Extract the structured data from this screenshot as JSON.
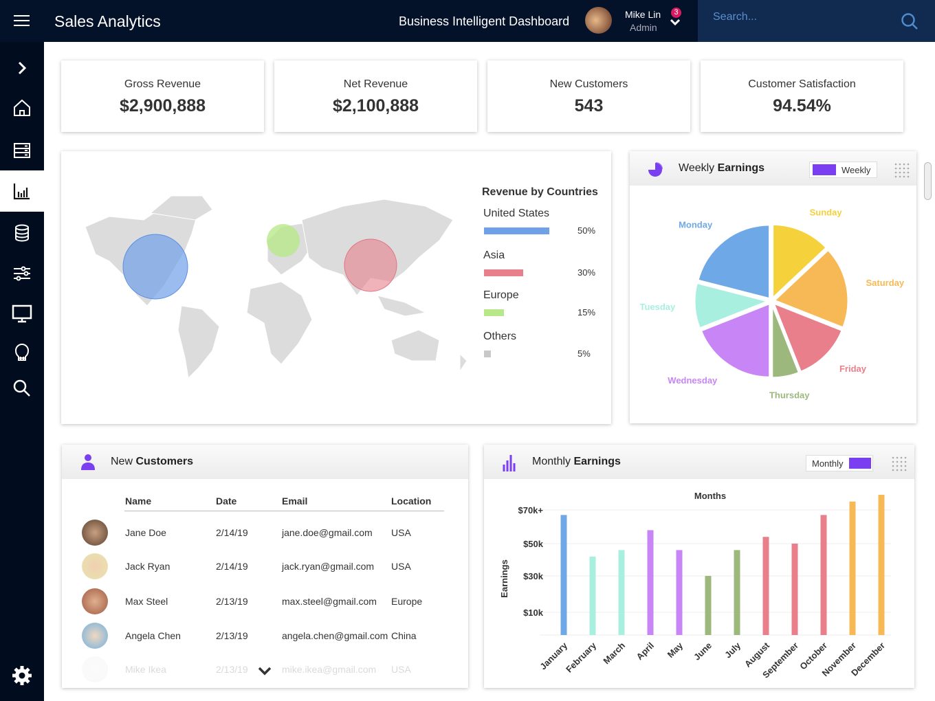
{
  "header": {
    "app_title": "Sales Analytics",
    "subtitle": "Business Intelligent Dashboard",
    "user_name": "Mike Lin",
    "user_role": "Admin",
    "notification_count": "3",
    "search_placeholder": "Search..."
  },
  "sidebar": {
    "items": [
      "expand",
      "home",
      "server",
      "analytics",
      "database",
      "settings-sliders",
      "monitor",
      "ideas",
      "search",
      "gear"
    ],
    "active": "analytics"
  },
  "kpis": [
    {
      "label": "Gross Revenue",
      "value": "$2,900,888"
    },
    {
      "label": "Net Revenue",
      "value": "$2,100,888"
    },
    {
      "label": "New Customers",
      "value": "543"
    },
    {
      "label": "Customer Satisfaction",
      "value": "94.54%"
    }
  ],
  "revenue_by_countries": {
    "title": "Revenue by Countries",
    "items": [
      {
        "name": "United States",
        "percent": "50%",
        "value": 50,
        "color": "#6fa0e8"
      },
      {
        "name": "Asia",
        "percent": "30%",
        "value": 30,
        "color": "#e8808c"
      },
      {
        "name": "Europe",
        "percent": "15%",
        "value": 15,
        "color": "#b8e88a"
      },
      {
        "name": "Others",
        "percent": "5%",
        "value": 5,
        "color": "#c8c8c8"
      }
    ]
  },
  "weekly": {
    "title_pre": "Weekly ",
    "title_bold": "Earnings",
    "toggle_label": "Weekly",
    "accent": "#7b3ff2",
    "chart_data": {
      "type": "pie",
      "slices": [
        {
          "label": "Sunday",
          "value": 13,
          "color": "#f5d13b"
        },
        {
          "label": "Saturday",
          "value": 18,
          "color": "#f7b955"
        },
        {
          "label": "Friday",
          "value": 13,
          "color": "#e87f8a"
        },
        {
          "label": "Thursday",
          "value": 6,
          "color": "#9db87c"
        },
        {
          "label": "Wednesday",
          "value": 19,
          "color": "#c885f5"
        },
        {
          "label": "Tuesday",
          "value": 10,
          "color": "#a8efe0"
        },
        {
          "label": "Monday",
          "value": 21,
          "color": "#6fa8e6"
        }
      ]
    }
  },
  "customers": {
    "title_pre": "New ",
    "title_bold": "Customers",
    "columns": [
      "Name",
      "Date",
      "Email",
      "Location"
    ],
    "rows": [
      {
        "name": "Jane Doe",
        "date": "2/14/19",
        "email": "jane.doe@gmail.com",
        "location": "USA"
      },
      {
        "name": "Jack Ryan",
        "date": "2/14/19",
        "email": "jack.ryan@gmail.com",
        "location": "USA"
      },
      {
        "name": "Max Steel",
        "date": "2/13/19",
        "email": "max.steel@gmail.com",
        "location": "Europe"
      },
      {
        "name": "Angela Chen",
        "date": "2/13/19",
        "email": "angela.chen@gmail.com",
        "location": "China"
      },
      {
        "name": "Mike Ikea",
        "date": "2/13/19",
        "email": "mike.ikea@gmail.com",
        "location": "USA"
      }
    ]
  },
  "monthly": {
    "title_pre": "Monthly ",
    "title_bold": "Earnings",
    "toggle_label": "Monthly",
    "chart_data": {
      "type": "bar",
      "title": "Months",
      "ylabel": "Earnings",
      "yticks": [
        "$10k",
        "$30k",
        "$50k",
        "$70k+"
      ],
      "grid": true,
      "categories": [
        "January",
        "February",
        "March",
        "April",
        "May",
        "June",
        "July",
        "August",
        "September",
        "October",
        "November",
        "December"
      ],
      "values": [
        67,
        42,
        46,
        58,
        46,
        30,
        46,
        54,
        50,
        67,
        75,
        79
      ],
      "colors": [
        "#6fa8e6",
        "#a8efe0",
        "#a8efe0",
        "#c885f5",
        "#c885f5",
        "#9db87c",
        "#9db87c",
        "#e87f8a",
        "#e87f8a",
        "#e87f8a",
        "#f7b955",
        "#f7b955"
      ]
    }
  }
}
